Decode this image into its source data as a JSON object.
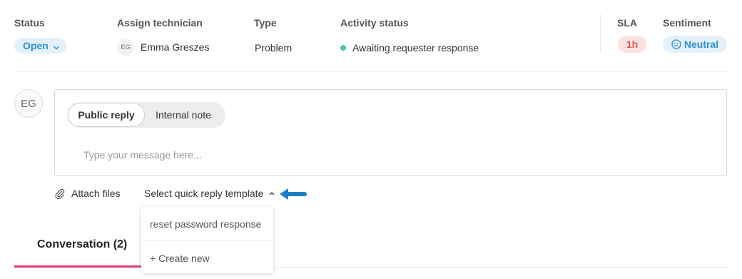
{
  "header": {
    "status_label": "Status",
    "status_value": "Open",
    "technician_label": "Assign technician",
    "technician_initials": "EG",
    "technician_name": "Emma Greszes",
    "type_label": "Type",
    "type_value": "Problem",
    "activity_label": "Activity status",
    "activity_value": "Awaiting requester response",
    "sla_label": "SLA",
    "sla_value": "1h",
    "sentiment_label": "Sentiment",
    "sentiment_value": "Neutral"
  },
  "composer": {
    "user_initials": "EG",
    "tab_public": "Public reply",
    "tab_internal": "Internal note",
    "message_placeholder": "Type your message here..."
  },
  "actions": {
    "attach_label": "Attach files",
    "template_label": "Select quick reply template"
  },
  "template_dropdown": {
    "items": [
      {
        "label": "reset password response"
      },
      {
        "label": "+ Create new"
      }
    ]
  },
  "tabs": {
    "conversation_label": "Conversation (2)"
  },
  "colors": {
    "accent_blue": "#2c8fd6",
    "activity_dot": "#4cc9a0",
    "sla_red": "#e2554b",
    "tab_underline": "#e03a7a",
    "annotation_arrow": "#1a7fc4"
  },
  "icons": {
    "status_chevron": "chevron-down-icon",
    "sentiment_face": "neutral-face-icon",
    "attach": "paperclip-icon",
    "template_chevron": "chevron-up-icon",
    "annotation": "arrow-left-icon"
  }
}
